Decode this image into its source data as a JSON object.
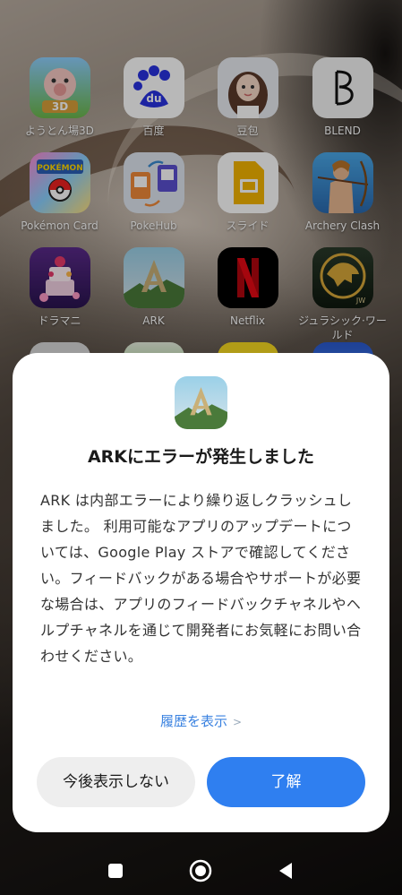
{
  "home_screen": {
    "apps": [
      {
        "label": "ようとん場3D",
        "icon": "pig-3d-icon"
      },
      {
        "label": "百度",
        "icon": "baidu-paw-icon"
      },
      {
        "label": "豆包",
        "icon": "doubao-avatar-icon"
      },
      {
        "label": "BLEND",
        "icon": "blend-b-icon"
      },
      {
        "label": "Pokémon Card",
        "icon": "pokemon-card-icon"
      },
      {
        "label": "PokeHub",
        "icon": "pokehub-icon"
      },
      {
        "label": "スライド",
        "icon": "slides-icon"
      },
      {
        "label": "Archery Clash",
        "icon": "archery-clash-icon"
      },
      {
        "label": "ドラマニ",
        "icon": "dramani-icon"
      },
      {
        "label": "ARK",
        "icon": "ark-icon"
      },
      {
        "label": "Netflix",
        "icon": "netflix-icon"
      },
      {
        "label": "ジュラシック·ワールド",
        "icon": "jurassic-world-icon"
      }
    ]
  },
  "dialog": {
    "title": "ARKにエラーが発生しました",
    "message": "ARK は内部エラーにより繰り返しクラッシュしました。 利用可能なアプリのアップデートについては、Google Play ストアで確認してください。フィードバックがある場合やサポートが必要な場合は、アプリのフィードバックチャネルやヘルプチャネルを通じて開発者にお気軽にお問い合わせください。",
    "history_link": "履歴を表示",
    "history_chevron": ">",
    "dismiss_button": "今後表示しない",
    "ok_button": "了解",
    "accent_color": "#2f7ff0"
  },
  "navigation": {
    "recents": "recents-square-icon",
    "home": "home-circle-icon",
    "back": "back-triangle-icon"
  }
}
